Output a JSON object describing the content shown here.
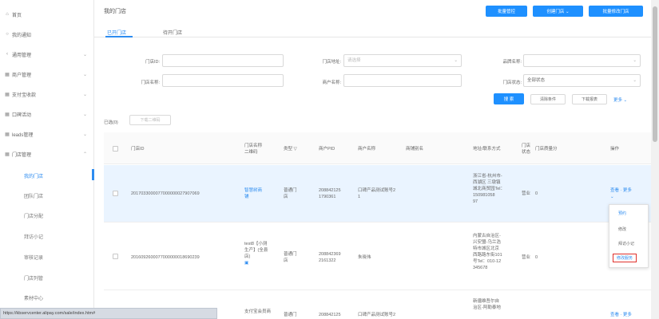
{
  "sidebar": {
    "items": [
      {
        "icon": "⌂",
        "label": "首页",
        "chev": ""
      },
      {
        "icon": "○",
        "label": "我的通知",
        "chev": ""
      },
      {
        "icon": "‹",
        "label": "通用管理",
        "chev": "⌄"
      },
      {
        "icon": "▦",
        "label": "商户管理",
        "chev": "⌄"
      },
      {
        "icon": "▦",
        "label": "支付宝收款",
        "chev": "⌄"
      },
      {
        "icon": "▦",
        "label": "口碑活动",
        "chev": "⌄"
      },
      {
        "icon": "▦",
        "label": "leads管理",
        "chev": "⌄"
      },
      {
        "icon": "▦",
        "label": "门店管理",
        "chev": "⌃"
      }
    ],
    "sub_items": [
      "我的门店",
      "团队门店",
      "门店分配",
      "拜访小记",
      "审核记录",
      "门店列管",
      "素材中心"
    ]
  },
  "header": {
    "title": "我的门店",
    "btn_batch_manage": "批量管控",
    "btn_create_store": "创建门店 ⌄",
    "btn_batch_edit": "批量修改门店"
  },
  "tabs": {
    "active": "已开门店",
    "other": "待开门店"
  },
  "filters": {
    "store_id_label": "门店ID:",
    "store_addr_label": "门店地址:",
    "store_addr_placeholder": "请选择",
    "brand_label": "品牌名称:",
    "store_name_label": "门店名称:",
    "merchant_pid_label": "商户名称:",
    "store_status_label": "门店状态:",
    "store_status_value": "全部状态",
    "search_btn": "搜 索",
    "clear_btn": "清除条件",
    "download_btn": "下载报表",
    "more_link": "更多 ⌄"
  },
  "table_toolbar": {
    "selected": "已选(0)",
    "download_qr": "下载二维码"
  },
  "table": {
    "headers": {
      "store_id": "门店ID",
      "name_qr": "门店名称\n二维码",
      "type": "类型 ▽",
      "pid": "商户PID",
      "merchant_name": "商户名称",
      "alias": "商铺别名",
      "address": "地址/联系方式",
      "status": "门店\n状态",
      "score": "门店质量分",
      "action": "操作"
    },
    "rows": [
      {
        "id": "2017033000077000000027907069",
        "name": "智慧树商\n铺",
        "type": "普通门\n店",
        "pid": "208842125\n1790361",
        "merchant": "口碑产品测试账号2\n1",
        "address": "浙江省-杭州市-\n西湖区 三墩镇\n城北商贸园Tel：\n150981058\n97",
        "status": "营业",
        "score": "0",
        "action": "查看 · 更多\n⌄"
      },
      {
        "id": "2016092600077000000018690239",
        "name": "test8【小测\n生产】(全县\n店)",
        "type": "普通门\n店",
        "pid": "208842369\n2161322",
        "merchant": "朱晓伟",
        "address": "内蒙古自治区-\n兴安盟-乌兰浩\n特市城区北京\n西路路东街101\n号Tel：010-12\n345678",
        "status": "营业",
        "score": "0",
        "action": ""
      },
      {
        "id": "",
        "name": "支付宝会员商",
        "type": "普通门",
        "pid": "208842125",
        "merchant": "口碑产品测试账号2",
        "address": "新疆维吾尔自\n治区-阿勒泰地",
        "status": "",
        "score": "",
        "action": "查看 · 更多"
      }
    ]
  },
  "dropdown": {
    "items": [
      "预约",
      "修改",
      "拜访小记",
      "修改服务"
    ]
  },
  "status_url": "https://kbservcenter.alipay.com/sale/index.htm#"
}
